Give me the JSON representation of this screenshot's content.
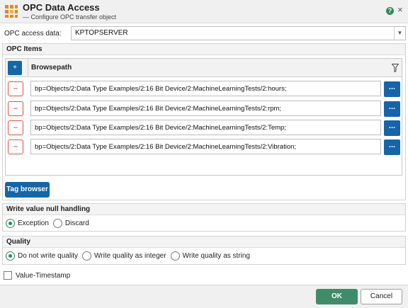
{
  "window": {
    "title": "OPC Data Access",
    "subtitle": "— Configure OPC transfer object",
    "app_icon": "grid-workflow-icon",
    "help_icon_glyph": "?",
    "close_icon_glyph": "×"
  },
  "opc_access": {
    "label": "OPC access data:",
    "value": "KPTOPSERVER"
  },
  "opc_items": {
    "header": "OPC Items",
    "add_glyph": "+",
    "column_title": "Browsepath",
    "remove_glyph": "−",
    "browse_glyph": "...",
    "rows": [
      {
        "path": "bp=Objects/2:Data Type Examples/2:16 Bit Device/2:MachineLearningTests/2:hours;"
      },
      {
        "path": "bp=Objects/2:Data Type Examples/2:16 Bit Device/2:MachineLearningTests/2:rpm;"
      },
      {
        "path": "bp=Objects/2:Data Type Examples/2:16 Bit Device/2:MachineLearningTests/2:Temp;"
      },
      {
        "path": "bp=Objects/2:Data Type Examples/2:16 Bit Device/2:MachineLearningTests/2:Vibration;"
      }
    ],
    "tag_browser_label": "Tag browser"
  },
  "null_handling": {
    "header": "Write value null handling",
    "options": [
      {
        "label": "Exception",
        "checked": true
      },
      {
        "label": "Discard",
        "checked": false
      }
    ]
  },
  "quality": {
    "header": "Quality",
    "options": [
      {
        "label": "Do not write quality",
        "checked": true
      },
      {
        "label": "Write quality as integer",
        "checked": false
      },
      {
        "label": "Write quality as string",
        "checked": false
      }
    ]
  },
  "timestamp": {
    "label": "Value-Timestamp",
    "checked": false
  },
  "footer": {
    "ok_label": "OK",
    "cancel_label": "Cancel"
  },
  "colors": {
    "primary_blue": "#1565a8",
    "accent_green": "#2c8a5c",
    "ok_green": "#3f8c69",
    "remove_red": "#d43c24"
  }
}
